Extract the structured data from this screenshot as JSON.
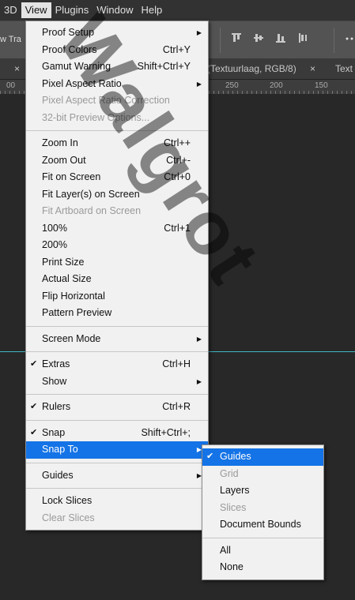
{
  "menubar": {
    "items": [
      "3D",
      "View",
      "Plugins",
      "Window",
      "Help"
    ],
    "active": "View"
  },
  "options_bar": {
    "partial_label": "w Tra"
  },
  "tabs": {
    "close_glyph": "×",
    "doc_tab": "(Textuurlaag, RGB/8)",
    "doc_tab_close": "×",
    "partial_tab": "Text"
  },
  "ruler": {
    "labels": [
      "00",
      "250",
      "200",
      "150"
    ]
  },
  "watermark": {
    "text": "Walgrot"
  },
  "view_menu": {
    "groups": [
      [
        {
          "label": "Proof Setup",
          "submenu": true
        },
        {
          "label": "Proof Colors",
          "shortcut": "Ctrl+Y"
        },
        {
          "label": "Gamut Warning",
          "shortcut": "Shift+Ctrl+Y"
        },
        {
          "label": "Pixel Aspect Ratio",
          "submenu": true
        },
        {
          "label": "Pixel Aspect Ratio Correction",
          "disabled": true
        },
        {
          "label": "32-bit Preview Options...",
          "disabled": true
        }
      ],
      [
        {
          "label": "Zoom In",
          "shortcut": "Ctrl++"
        },
        {
          "label": "Zoom Out",
          "shortcut": "Ctrl+-"
        },
        {
          "label": "Fit on Screen",
          "shortcut": "Ctrl+0"
        },
        {
          "label": "Fit Layer(s) on Screen"
        },
        {
          "label": "Fit Artboard on Screen",
          "disabled": true
        },
        {
          "label": "100%",
          "shortcut": "Ctrl+1"
        },
        {
          "label": "200%"
        },
        {
          "label": "Print Size"
        },
        {
          "label": "Actual Size"
        },
        {
          "label": "Flip Horizontal"
        },
        {
          "label": "Pattern Preview"
        }
      ],
      [
        {
          "label": "Screen Mode",
          "submenu": true
        }
      ],
      [
        {
          "label": "Extras",
          "shortcut": "Ctrl+H",
          "checked": true
        },
        {
          "label": "Show",
          "submenu": true
        }
      ],
      [
        {
          "label": "Rulers",
          "shortcut": "Ctrl+R",
          "checked": true
        }
      ],
      [
        {
          "label": "Snap",
          "shortcut": "Shift+Ctrl+;",
          "checked": true
        },
        {
          "label": "Snap To",
          "submenu": true,
          "highlighted": true
        }
      ],
      [
        {
          "label": "Guides",
          "submenu": true
        }
      ],
      [
        {
          "label": "Lock Slices"
        },
        {
          "label": "Clear Slices",
          "disabled": true
        }
      ]
    ]
  },
  "snap_to_menu": {
    "groups": [
      [
        {
          "label": "Guides",
          "checked": true,
          "highlighted": true
        },
        {
          "label": "Grid",
          "disabled": true
        },
        {
          "label": "Layers"
        },
        {
          "label": "Slices",
          "disabled": true
        },
        {
          "label": "Document Bounds"
        }
      ],
      [
        {
          "label": "All"
        },
        {
          "label": "None"
        }
      ]
    ]
  },
  "glyphs": {
    "check": "✔",
    "submenu_arrow": "▶"
  },
  "colors": {
    "highlight": "#1473e6",
    "menu_bg": "#f1f1f1",
    "guide": "#3fb7c6"
  }
}
